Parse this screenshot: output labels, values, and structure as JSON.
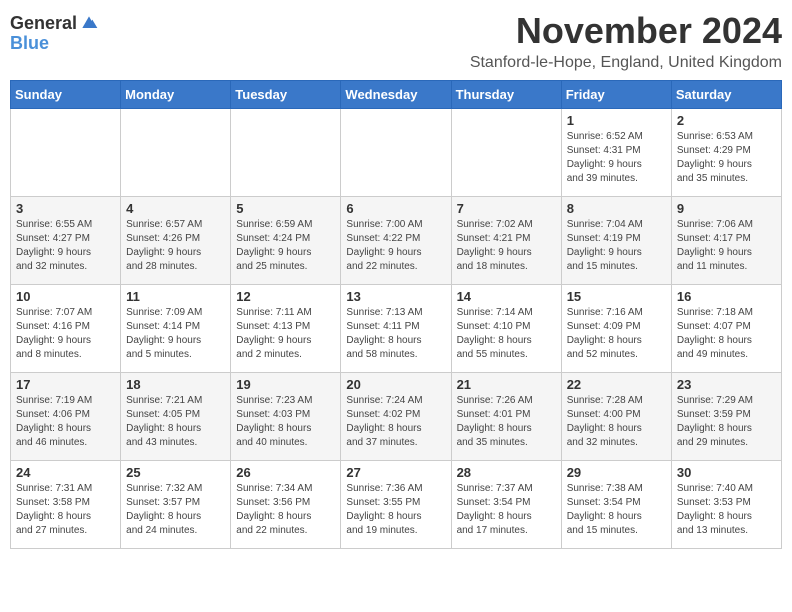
{
  "logo": {
    "line1": "General",
    "line2": "Blue"
  },
  "title": "November 2024",
  "subtitle": "Stanford-le-Hope, England, United Kingdom",
  "weekdays": [
    "Sunday",
    "Monday",
    "Tuesday",
    "Wednesday",
    "Thursday",
    "Friday",
    "Saturday"
  ],
  "weeks": [
    [
      {
        "day": "",
        "info": ""
      },
      {
        "day": "",
        "info": ""
      },
      {
        "day": "",
        "info": ""
      },
      {
        "day": "",
        "info": ""
      },
      {
        "day": "",
        "info": ""
      },
      {
        "day": "1",
        "info": "Sunrise: 6:52 AM\nSunset: 4:31 PM\nDaylight: 9 hours\nand 39 minutes."
      },
      {
        "day": "2",
        "info": "Sunrise: 6:53 AM\nSunset: 4:29 PM\nDaylight: 9 hours\nand 35 minutes."
      }
    ],
    [
      {
        "day": "3",
        "info": "Sunrise: 6:55 AM\nSunset: 4:27 PM\nDaylight: 9 hours\nand 32 minutes."
      },
      {
        "day": "4",
        "info": "Sunrise: 6:57 AM\nSunset: 4:26 PM\nDaylight: 9 hours\nand 28 minutes."
      },
      {
        "day": "5",
        "info": "Sunrise: 6:59 AM\nSunset: 4:24 PM\nDaylight: 9 hours\nand 25 minutes."
      },
      {
        "day": "6",
        "info": "Sunrise: 7:00 AM\nSunset: 4:22 PM\nDaylight: 9 hours\nand 22 minutes."
      },
      {
        "day": "7",
        "info": "Sunrise: 7:02 AM\nSunset: 4:21 PM\nDaylight: 9 hours\nand 18 minutes."
      },
      {
        "day": "8",
        "info": "Sunrise: 7:04 AM\nSunset: 4:19 PM\nDaylight: 9 hours\nand 15 minutes."
      },
      {
        "day": "9",
        "info": "Sunrise: 7:06 AM\nSunset: 4:17 PM\nDaylight: 9 hours\nand 11 minutes."
      }
    ],
    [
      {
        "day": "10",
        "info": "Sunrise: 7:07 AM\nSunset: 4:16 PM\nDaylight: 9 hours\nand 8 minutes."
      },
      {
        "day": "11",
        "info": "Sunrise: 7:09 AM\nSunset: 4:14 PM\nDaylight: 9 hours\nand 5 minutes."
      },
      {
        "day": "12",
        "info": "Sunrise: 7:11 AM\nSunset: 4:13 PM\nDaylight: 9 hours\nand 2 minutes."
      },
      {
        "day": "13",
        "info": "Sunrise: 7:13 AM\nSunset: 4:11 PM\nDaylight: 8 hours\nand 58 minutes."
      },
      {
        "day": "14",
        "info": "Sunrise: 7:14 AM\nSunset: 4:10 PM\nDaylight: 8 hours\nand 55 minutes."
      },
      {
        "day": "15",
        "info": "Sunrise: 7:16 AM\nSunset: 4:09 PM\nDaylight: 8 hours\nand 52 minutes."
      },
      {
        "day": "16",
        "info": "Sunrise: 7:18 AM\nSunset: 4:07 PM\nDaylight: 8 hours\nand 49 minutes."
      }
    ],
    [
      {
        "day": "17",
        "info": "Sunrise: 7:19 AM\nSunset: 4:06 PM\nDaylight: 8 hours\nand 46 minutes."
      },
      {
        "day": "18",
        "info": "Sunrise: 7:21 AM\nSunset: 4:05 PM\nDaylight: 8 hours\nand 43 minutes."
      },
      {
        "day": "19",
        "info": "Sunrise: 7:23 AM\nSunset: 4:03 PM\nDaylight: 8 hours\nand 40 minutes."
      },
      {
        "day": "20",
        "info": "Sunrise: 7:24 AM\nSunset: 4:02 PM\nDaylight: 8 hours\nand 37 minutes."
      },
      {
        "day": "21",
        "info": "Sunrise: 7:26 AM\nSunset: 4:01 PM\nDaylight: 8 hours\nand 35 minutes."
      },
      {
        "day": "22",
        "info": "Sunrise: 7:28 AM\nSunset: 4:00 PM\nDaylight: 8 hours\nand 32 minutes."
      },
      {
        "day": "23",
        "info": "Sunrise: 7:29 AM\nSunset: 3:59 PM\nDaylight: 8 hours\nand 29 minutes."
      }
    ],
    [
      {
        "day": "24",
        "info": "Sunrise: 7:31 AM\nSunset: 3:58 PM\nDaylight: 8 hours\nand 27 minutes."
      },
      {
        "day": "25",
        "info": "Sunrise: 7:32 AM\nSunset: 3:57 PM\nDaylight: 8 hours\nand 24 minutes."
      },
      {
        "day": "26",
        "info": "Sunrise: 7:34 AM\nSunset: 3:56 PM\nDaylight: 8 hours\nand 22 minutes."
      },
      {
        "day": "27",
        "info": "Sunrise: 7:36 AM\nSunset: 3:55 PM\nDaylight: 8 hours\nand 19 minutes."
      },
      {
        "day": "28",
        "info": "Sunrise: 7:37 AM\nSunset: 3:54 PM\nDaylight: 8 hours\nand 17 minutes."
      },
      {
        "day": "29",
        "info": "Sunrise: 7:38 AM\nSunset: 3:54 PM\nDaylight: 8 hours\nand 15 minutes."
      },
      {
        "day": "30",
        "info": "Sunrise: 7:40 AM\nSunset: 3:53 PM\nDaylight: 8 hours\nand 13 minutes."
      }
    ]
  ]
}
